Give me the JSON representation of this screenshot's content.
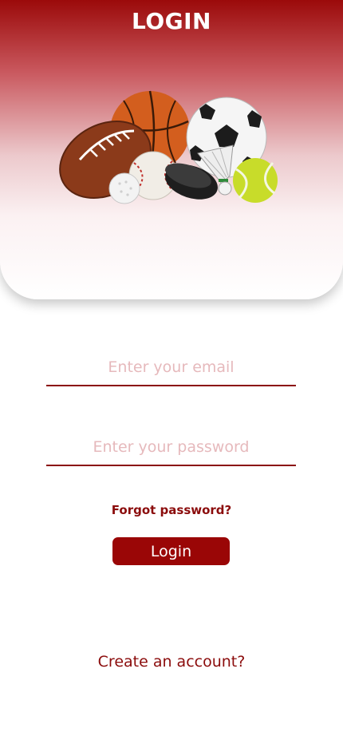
{
  "header": {
    "title": "LOGIN",
    "image_icon": "sports-balls-illustration"
  },
  "form": {
    "email": {
      "value": "",
      "placeholder": "Enter your email"
    },
    "password": {
      "value": "",
      "placeholder": "Enter your password"
    },
    "forgot_label": "Forgot password?",
    "login_label": "Login",
    "create_account_label": "Create an account?"
  },
  "colors": {
    "accent": "#9a0606",
    "placeholder": "#e6b9bc",
    "header_top": "#9b0a0a"
  }
}
